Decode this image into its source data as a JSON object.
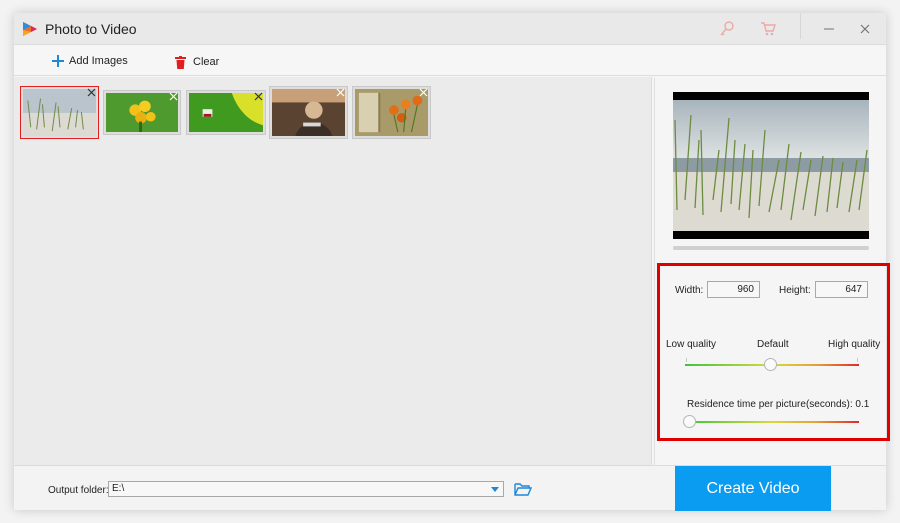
{
  "window": {
    "title": "Photo to Video",
    "app_icon": "app-logo-icon",
    "title_icons": [
      "key-icon",
      "cart-icon"
    ],
    "controls": [
      "minimize-icon",
      "close-icon"
    ]
  },
  "toolbar": {
    "add_images_label": "Add Images",
    "add_images_icon": "plus-icon",
    "clear_label": "Clear",
    "clear_icon": "trash-icon"
  },
  "gallery": {
    "thumbnails": [
      {
        "name": "beach-grass",
        "selected": true,
        "close_icon": "close-icon"
      },
      {
        "name": "yellow-flowers",
        "selected": false,
        "close_icon": "close-icon"
      },
      {
        "name": "green-field-car",
        "selected": false,
        "close_icon": "close-icon"
      },
      {
        "name": "girl-autumn",
        "selected": false,
        "close_icon": "close-icon"
      },
      {
        "name": "tulips-window",
        "selected": false,
        "close_icon": "close-icon"
      }
    ]
  },
  "settings": {
    "width_label": "Width:",
    "width_value": "960",
    "height_label": "Height:",
    "height_value": "647",
    "quality": {
      "low_label": "Low quality",
      "default_label": "Default",
      "high_label": "High quality",
      "value_fraction": 0.5
    },
    "residence": {
      "label": "Residence time per picture(seconds): 0.1",
      "value_seconds": 0.1,
      "value_fraction": 0.0
    }
  },
  "colors": {
    "accent": "#0a9cf0",
    "highlight_border": "#e00000",
    "selected_thumb_border": "#e02020",
    "icon_red": "#e02020",
    "icon_blue": "#1e88d8"
  },
  "bottom": {
    "output_label": "Output folder:",
    "output_value": "E:\\",
    "folder_icon": "folder-icon",
    "create_label": "Create Video"
  }
}
